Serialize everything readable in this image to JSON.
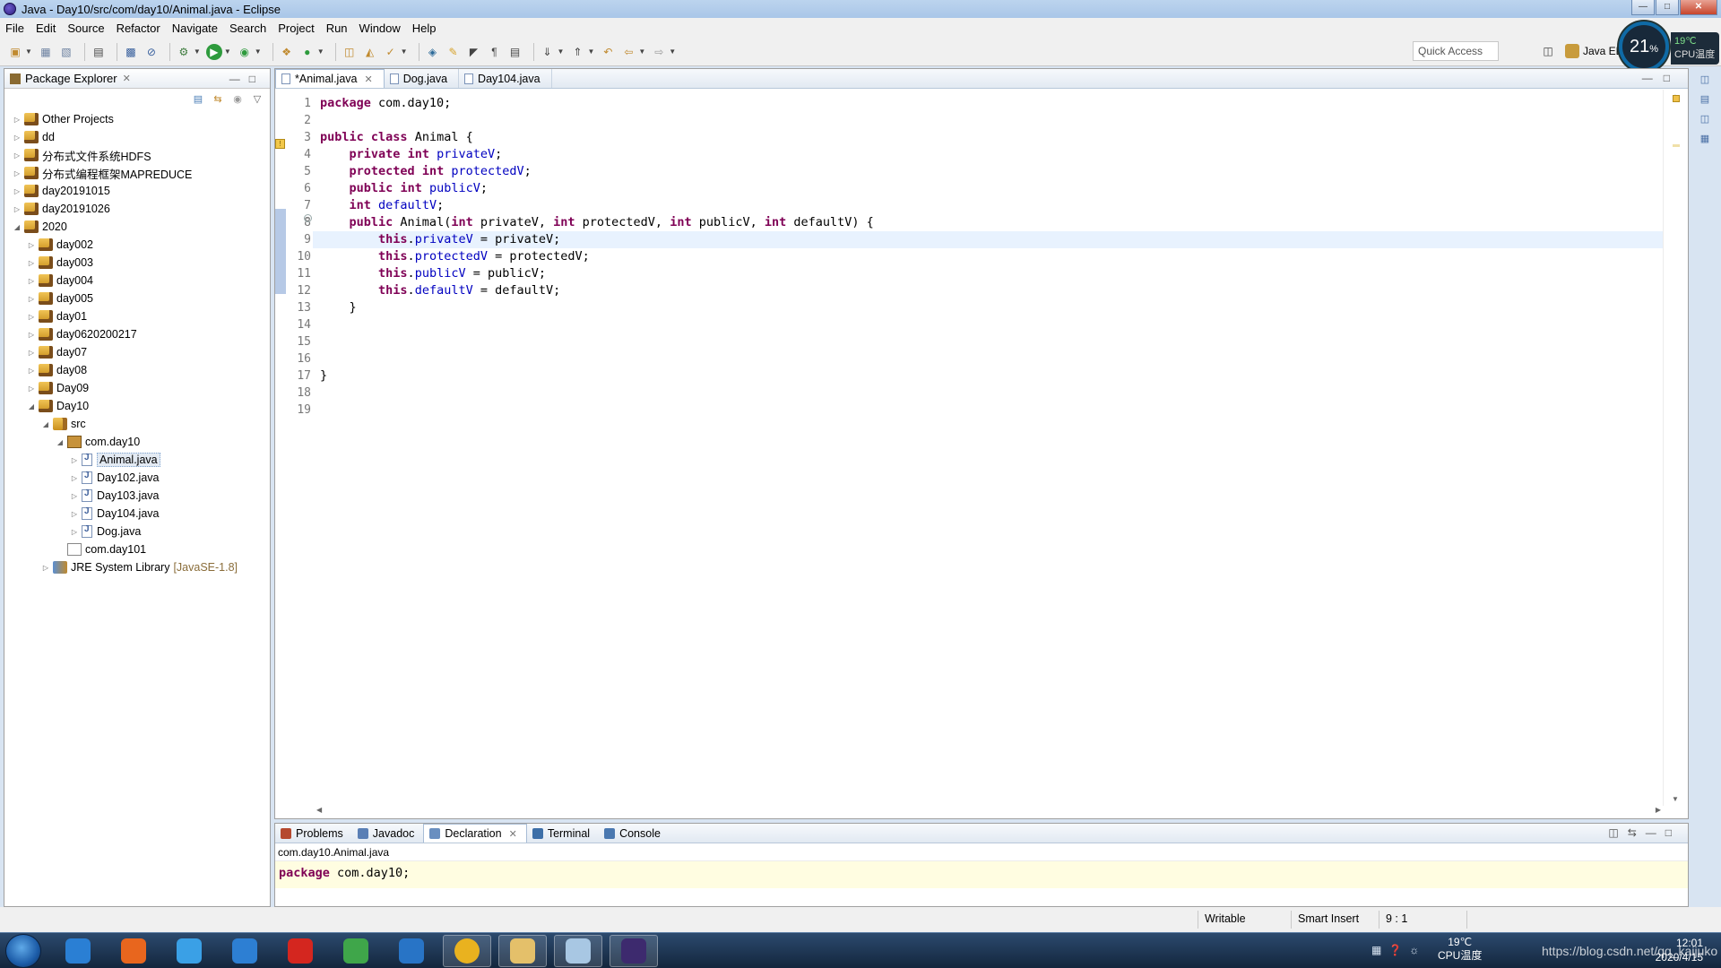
{
  "window": {
    "title": "Java - Day10/src/com/day10/Animal.java - Eclipse"
  },
  "menu": [
    "File",
    "Edit",
    "Source",
    "Refactor",
    "Navigate",
    "Search",
    "Project",
    "Run",
    "Window",
    "Help"
  ],
  "toolbar": {
    "quick_access": "Quick Access",
    "perspective": "Java EE"
  },
  "cpu_widget": {
    "percent": "21",
    "unit": "%",
    "temp": "19℃",
    "label": "CPU温度"
  },
  "package_explorer": {
    "title": "Package Explorer",
    "items": [
      {
        "label": "Other Projects",
        "depth": 0,
        "icon": "project",
        "expanded": false
      },
      {
        "label": "dd",
        "depth": 0,
        "icon": "project",
        "expanded": false
      },
      {
        "label": "分布式文件系统HDFS",
        "depth": 0,
        "icon": "project",
        "expanded": false
      },
      {
        "label": "分布式编程框架MAPREDUCE",
        "depth": 0,
        "icon": "project",
        "expanded": false
      },
      {
        "label": "day20191015",
        "depth": 0,
        "icon": "project",
        "expanded": false
      },
      {
        "label": "day20191026",
        "depth": 0,
        "icon": "project",
        "expanded": false
      },
      {
        "label": "2020",
        "depth": 0,
        "icon": "project",
        "expanded": true
      },
      {
        "label": "day002",
        "depth": 1,
        "icon": "project",
        "expanded": false
      },
      {
        "label": "day003",
        "depth": 1,
        "icon": "project",
        "expanded": false
      },
      {
        "label": "day004",
        "depth": 1,
        "icon": "project",
        "expanded": false
      },
      {
        "label": "day005",
        "depth": 1,
        "icon": "project",
        "expanded": false
      },
      {
        "label": "day01",
        "depth": 1,
        "icon": "project",
        "expanded": false
      },
      {
        "label": "day0620200217",
        "depth": 1,
        "icon": "project",
        "expanded": false
      },
      {
        "label": "day07",
        "depth": 1,
        "icon": "project",
        "expanded": false
      },
      {
        "label": "day08",
        "depth": 1,
        "icon": "project",
        "expanded": false
      },
      {
        "label": "Day09",
        "depth": 1,
        "icon": "project",
        "expanded": false
      },
      {
        "label": "Day10",
        "depth": 1,
        "icon": "project",
        "expanded": true
      },
      {
        "label": "src",
        "depth": 2,
        "icon": "src",
        "expanded": true
      },
      {
        "label": "com.day10",
        "depth": 3,
        "icon": "package",
        "expanded": true
      },
      {
        "label": "Animal.java",
        "depth": 4,
        "icon": "java",
        "expanded": false,
        "selected": true
      },
      {
        "label": "Day102.java",
        "depth": 4,
        "icon": "java",
        "expanded": false
      },
      {
        "label": "Day103.java",
        "depth": 4,
        "icon": "java",
        "expanded": false
      },
      {
        "label": "Day104.java",
        "depth": 4,
        "icon": "java",
        "expanded": false
      },
      {
        "label": "Dog.java",
        "depth": 4,
        "icon": "java",
        "expanded": false
      },
      {
        "label": "com.day101",
        "depth": 3,
        "icon": "package-empty",
        "expanded": null
      },
      {
        "label": "JRE System Library",
        "depth": 2,
        "icon": "library",
        "expanded": false,
        "suffix": "[JavaSE-1.8]"
      }
    ]
  },
  "editor": {
    "tabs": [
      {
        "label": "*Animal.java",
        "active": true
      },
      {
        "label": "Dog.java",
        "active": false
      },
      {
        "label": "Day104.java",
        "active": false
      }
    ],
    "current_line": 9,
    "line_numbers": [
      "1",
      "2",
      "3",
      "4",
      "5",
      "6",
      "7",
      "8",
      "9",
      "10",
      "11",
      "12",
      "13",
      "14",
      "15",
      "16",
      "17",
      "18",
      "19"
    ],
    "lines": [
      [
        [
          "kw",
          "package"
        ],
        [
          "t",
          " com.day10;"
        ]
      ],
      [],
      [
        [
          "kw",
          "public"
        ],
        [
          "t",
          " "
        ],
        [
          "kw",
          "class"
        ],
        [
          "t",
          " Animal {"
        ]
      ],
      [
        [
          "t",
          "    "
        ],
        [
          "kw",
          "private"
        ],
        [
          "t",
          " "
        ],
        [
          "kw",
          "int"
        ],
        [
          "t",
          " "
        ],
        [
          "fld",
          "privateV"
        ],
        [
          "t",
          ";"
        ]
      ],
      [
        [
          "t",
          "    "
        ],
        [
          "kw",
          "protected"
        ],
        [
          "t",
          " "
        ],
        [
          "kw",
          "int"
        ],
        [
          "t",
          " "
        ],
        [
          "fld",
          "protectedV"
        ],
        [
          "t",
          ";"
        ]
      ],
      [
        [
          "t",
          "    "
        ],
        [
          "kw",
          "public"
        ],
        [
          "t",
          " "
        ],
        [
          "kw",
          "int"
        ],
        [
          "t",
          " "
        ],
        [
          "fld",
          "publicV"
        ],
        [
          "t",
          ";"
        ]
      ],
      [
        [
          "t",
          "    "
        ],
        [
          "kw",
          "int"
        ],
        [
          "t",
          " "
        ],
        [
          "fld",
          "defaultV"
        ],
        [
          "t",
          ";"
        ]
      ],
      [
        [
          "t",
          "    "
        ],
        [
          "kw",
          "public"
        ],
        [
          "t",
          " Animal("
        ],
        [
          "kw",
          "int"
        ],
        [
          "t",
          " privateV, "
        ],
        [
          "kw",
          "int"
        ],
        [
          "t",
          " protectedV, "
        ],
        [
          "kw",
          "int"
        ],
        [
          "t",
          " publicV, "
        ],
        [
          "kw",
          "int"
        ],
        [
          "t",
          " defaultV) {"
        ]
      ],
      [
        [
          "t",
          "        "
        ],
        [
          "kw",
          "this"
        ],
        [
          "t",
          "."
        ],
        [
          "fld",
          "privateV"
        ],
        [
          "t",
          " = privateV;"
        ]
      ],
      [
        [
          "t",
          "        "
        ],
        [
          "kw",
          "this"
        ],
        [
          "t",
          "."
        ],
        [
          "fld",
          "protectedV"
        ],
        [
          "t",
          " = protectedV;"
        ]
      ],
      [
        [
          "t",
          "        "
        ],
        [
          "kw",
          "this"
        ],
        [
          "t",
          "."
        ],
        [
          "fld",
          "publicV"
        ],
        [
          "t",
          " = publicV;"
        ]
      ],
      [
        [
          "t",
          "        "
        ],
        [
          "kw",
          "this"
        ],
        [
          "t",
          "."
        ],
        [
          "fld",
          "defaultV"
        ],
        [
          "t",
          " = defaultV;"
        ]
      ],
      [
        [
          "t",
          "    }"
        ]
      ],
      [],
      [],
      [],
      [
        [
          "t",
          "}"
        ]
      ],
      [],
      []
    ]
  },
  "bottom_panel": {
    "tabs": [
      {
        "label": "Problems",
        "active": false,
        "icon": "problems-icon"
      },
      {
        "label": "Javadoc",
        "active": false,
        "icon": "javadoc-icon"
      },
      {
        "label": "Declaration",
        "active": true,
        "icon": "declaration-icon"
      },
      {
        "label": "Terminal",
        "active": false,
        "icon": "terminal-icon"
      },
      {
        "label": "Console",
        "active": false,
        "icon": "console-icon"
      }
    ],
    "declaration_path": "com.day10.Animal.java",
    "declaration_code": [
      [
        "kw",
        "package"
      ],
      [
        "t",
        " com.day10;"
      ]
    ]
  },
  "status": {
    "writable": "Writable",
    "insert_mode": "Smart Insert",
    "position": "9 : 1"
  },
  "taskbar": {
    "apps": [
      "internet-explorer",
      "firefox",
      "baidu-netdisk",
      "cloud-drive",
      "youdao-dictionary",
      "ie-alt",
      "ie",
      "chrome",
      "file-explorer",
      "notepad",
      "eclipse"
    ],
    "weather_temp": "19℃",
    "weather_label": "CPU温度",
    "watermark": "https://blog.csdn.net/qq_kaijuko",
    "time": "12:01",
    "date": "2020/4/15"
  },
  "colors": {
    "keyword": "#7f0055",
    "field": "#0000c0",
    "current_line": "#e8f2fe",
    "declaration_bg": "#fffde1"
  }
}
